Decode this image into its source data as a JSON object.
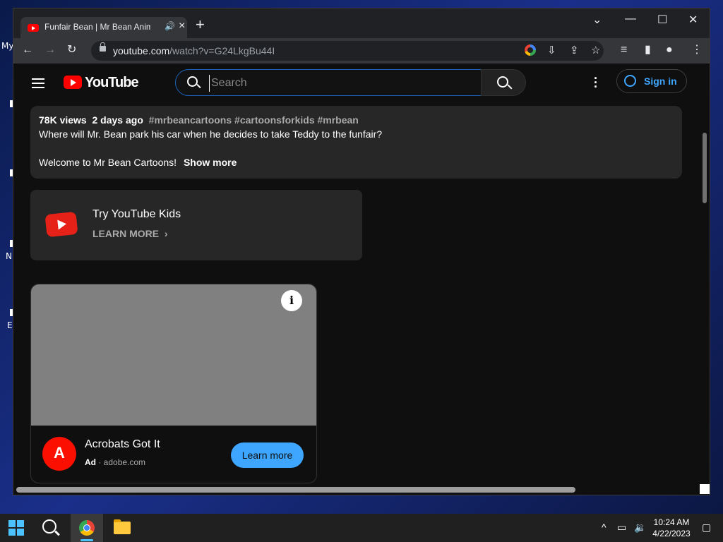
{
  "desktop": {
    "labels": [
      "My",
      "N",
      "E"
    ]
  },
  "browser": {
    "tab_title": "Funfair Bean | Mr Bean Anim",
    "url_host": "youtube.com",
    "url_path": "/watch?v=G24LkgBu44I"
  },
  "youtube": {
    "logo_text": "YouTube",
    "search_placeholder": "Search",
    "sign_in": "Sign in",
    "description": {
      "views": "78K views",
      "date": "2 days ago",
      "tags": "#mrbeancartoons #cartoonsforkids #mrbean",
      "line1": "Where will Mr. Bean park his car when he decides to take Teddy to the funfair?",
      "line2": "Welcome to Mr Bean Cartoons!",
      "show_more": "Show more"
    },
    "kids": {
      "title": "Try YouTube Kids",
      "learn_more": "LEARN MORE"
    },
    "ad": {
      "headline": "Acrobats Got It",
      "ad_label": "Ad",
      "domain": "adobe.com",
      "button": "Learn more"
    }
  },
  "taskbar": {
    "time": "10:24 AM",
    "date": "4/22/2023"
  }
}
